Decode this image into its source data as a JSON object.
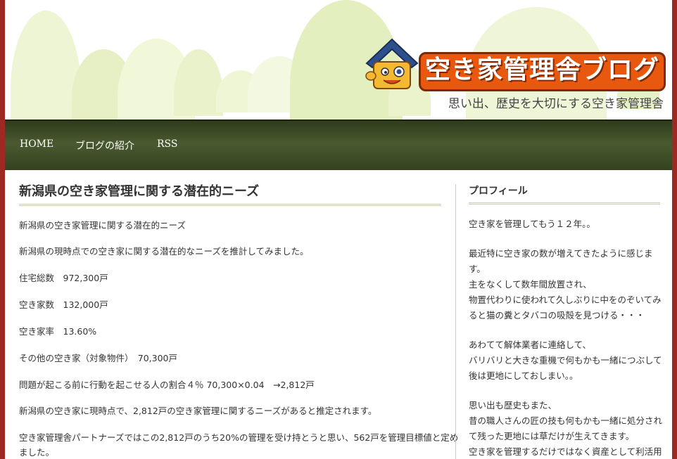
{
  "header": {
    "blog_title": "空き家管理舎ブログ",
    "tagline": "思い出、歴史を大切にする空き家管理舎"
  },
  "nav": {
    "items": [
      {
        "label": "HOME"
      },
      {
        "label": "ブログの紹介"
      },
      {
        "label": "RSS"
      }
    ]
  },
  "main": {
    "post_title": "新潟県の空き家管理に関する潜在的ニーズ",
    "paragraphs": [
      "新潟県の空き家管理に関する潜在的ニーズ",
      "新潟県の現時点での空き家に関する潜在的なニーズを推計してみました。",
      "住宅総数　972,300戸",
      "空き家数　132,000戸",
      "空き家率　13.60%",
      "その他の空き家（対象物件）　70,300戸",
      "問題が起こる前に行動を起こせる人の割合４％ 70,300×0.04　→2,812戸",
      "新潟県の空き家に現時点で、2,812戸の空き家管理に関するニーズがあると推定されます。",
      "空き家管理舎パートナーズではこの2,812戸のうち20%の管理を受け持とうと思い、562戸を管理目標値と定め",
      "ました。"
    ]
  },
  "sidebar": {
    "title": "プロフィール",
    "lines": [
      "空き家を管理してもう１２年。。",
      "最近特に空き家の数が増えてきたように感じま",
      "す。",
      "主をなくして数年間放置され、",
      "物置代わりに使われて久しぶりに中をのぞいてみ",
      "ると猫の糞とタバコの吸殻を見つける・・・",
      "あわてて解体業者に連絡して、",
      "バリバリと大きな重機で何もかも一緒につぶして",
      "後は更地にしておしまい。。",
      "思い出も歴史もまた、",
      "昔の職人さんの匠の技も何もかも一緒に処分され",
      "て残った更地には草だけが生えてきます。",
      "空き家を管理するだけではなく資産として利活用"
    ]
  },
  "colors": {
    "frame": "#9c2a22",
    "nav_bg": "#3c4a25",
    "logo_orange": "#e8580f"
  }
}
